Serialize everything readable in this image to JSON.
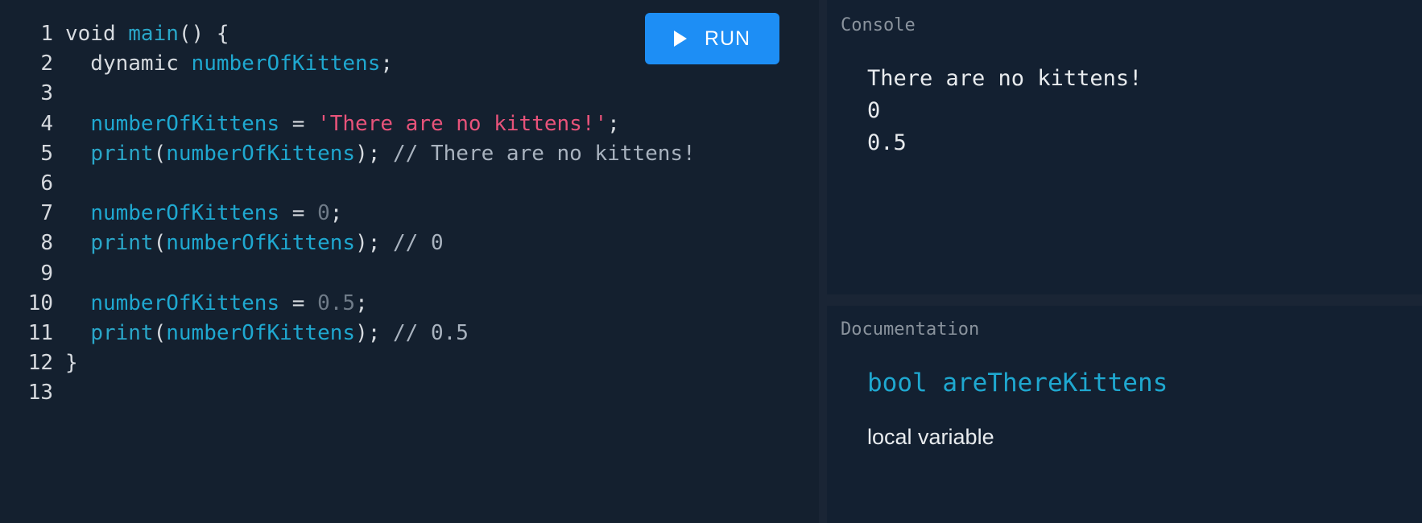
{
  "toolbar": {
    "run_label": "RUN",
    "run_icon": "play-icon"
  },
  "editor": {
    "lines": [
      {
        "num": "1",
        "tokens": [
          {
            "t": "void ",
            "c": "def"
          },
          {
            "t": "main",
            "c": "fn"
          },
          {
            "t": "() {",
            "c": "def"
          }
        ]
      },
      {
        "num": "2",
        "tokens": [
          {
            "t": "  dynamic ",
            "c": "def"
          },
          {
            "t": "numberOfKittens",
            "c": "id"
          },
          {
            "t": ";",
            "c": "def"
          }
        ]
      },
      {
        "num": "3",
        "tokens": []
      },
      {
        "num": "4",
        "tokens": [
          {
            "t": "  ",
            "c": "def"
          },
          {
            "t": "numberOfKittens",
            "c": "id"
          },
          {
            "t": " = ",
            "c": "def"
          },
          {
            "t": "'There are no kittens!'",
            "c": "str"
          },
          {
            "t": ";",
            "c": "def"
          }
        ]
      },
      {
        "num": "5",
        "tokens": [
          {
            "t": "  ",
            "c": "def"
          },
          {
            "t": "print",
            "c": "fn"
          },
          {
            "t": "(",
            "c": "def"
          },
          {
            "t": "numberOfKittens",
            "c": "id"
          },
          {
            "t": "); ",
            "c": "def"
          },
          {
            "t": "// There are no kittens!",
            "c": "cmt"
          }
        ]
      },
      {
        "num": "6",
        "tokens": []
      },
      {
        "num": "7",
        "tokens": [
          {
            "t": "  ",
            "c": "def"
          },
          {
            "t": "numberOfKittens",
            "c": "id"
          },
          {
            "t": " = ",
            "c": "def"
          },
          {
            "t": "0",
            "c": "num"
          },
          {
            "t": ";",
            "c": "def"
          }
        ]
      },
      {
        "num": "8",
        "tokens": [
          {
            "t": "  ",
            "c": "def"
          },
          {
            "t": "print",
            "c": "fn"
          },
          {
            "t": "(",
            "c": "def"
          },
          {
            "t": "numberOfKittens",
            "c": "id"
          },
          {
            "t": "); ",
            "c": "def"
          },
          {
            "t": "// 0",
            "c": "cmt"
          }
        ]
      },
      {
        "num": "9",
        "tokens": []
      },
      {
        "num": "10",
        "tokens": [
          {
            "t": "  ",
            "c": "def"
          },
          {
            "t": "numberOfKittens",
            "c": "id"
          },
          {
            "t": " = ",
            "c": "def"
          },
          {
            "t": "0.5",
            "c": "num"
          },
          {
            "t": ";",
            "c": "def"
          }
        ]
      },
      {
        "num": "11",
        "tokens": [
          {
            "t": "  ",
            "c": "def"
          },
          {
            "t": "print",
            "c": "fn"
          },
          {
            "t": "(",
            "c": "def"
          },
          {
            "t": "numberOfKittens",
            "c": "id"
          },
          {
            "t": "); ",
            "c": "def"
          },
          {
            "t": "// 0.5",
            "c": "cmt"
          }
        ]
      },
      {
        "num": "12",
        "tokens": [
          {
            "t": "}",
            "c": "def"
          }
        ]
      },
      {
        "num": "13",
        "tokens": []
      }
    ]
  },
  "console": {
    "title": "Console",
    "lines": [
      "There are no kittens!",
      "0",
      "0.5"
    ]
  },
  "documentation": {
    "title": "Documentation",
    "heading": "bool areThereKittens",
    "description": "local variable"
  },
  "colors": {
    "accent": "#1d8ef5",
    "identifier": "#1fa8d0",
    "string": "#e8537a",
    "background": "#14202f"
  }
}
